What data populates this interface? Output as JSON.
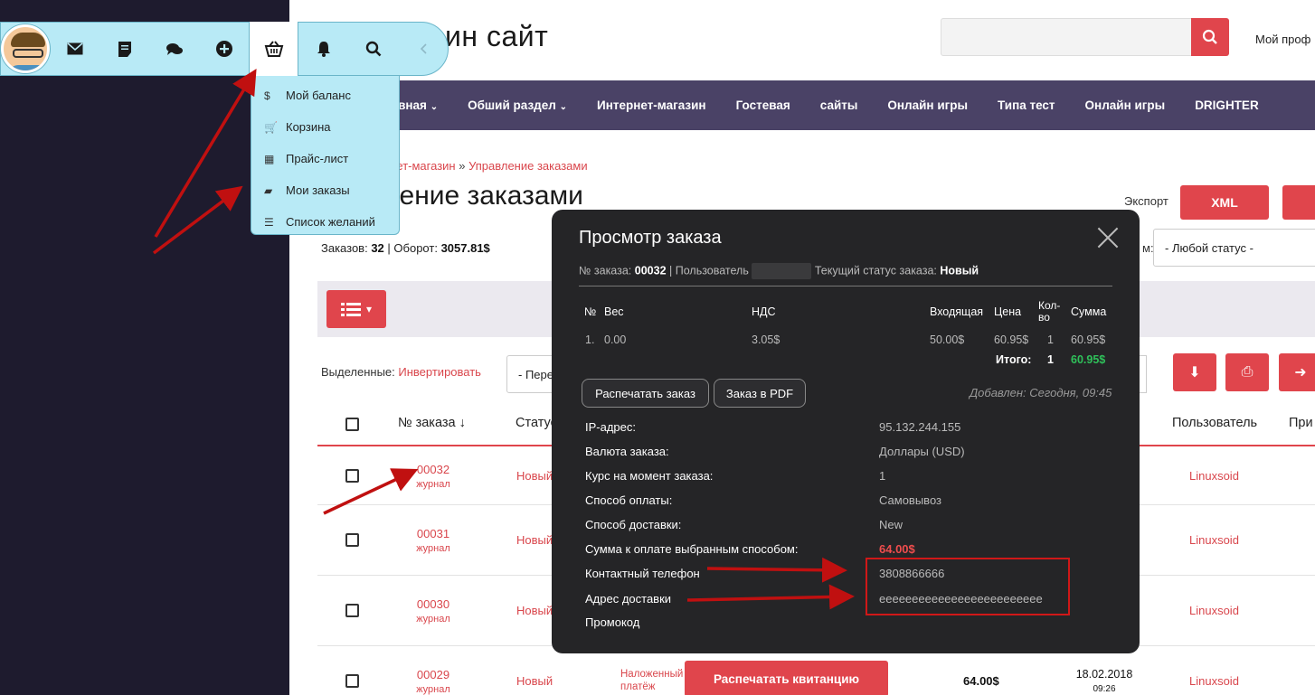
{
  "site": {
    "title": "ин сайт",
    "profile_label": "Мой проф"
  },
  "toolbar": {
    "icons": [
      "mail-icon",
      "notes-icon",
      "chat-icon",
      "plus-icon",
      "basket-icon",
      "bell-icon",
      "search-icon",
      "chevron-left-icon"
    ]
  },
  "dropdown": {
    "items": [
      {
        "icon": "$",
        "label": "Мой баланс"
      },
      {
        "icon": "🛒",
        "label": "Корзина"
      },
      {
        "icon": "▦",
        "label": "Прайс-лист"
      },
      {
        "icon": "▰",
        "label": "Мои заказы"
      },
      {
        "icon": "☰",
        "label": "Список желаний"
      }
    ]
  },
  "nav": {
    "items": [
      "лавная",
      "Обший раздел",
      "Интернет-магазин",
      "Гостевая",
      "сайты",
      "Онлайн игры",
      "Типа тест",
      "Онлайн игры",
      "DRIGHTER"
    ]
  },
  "breadcrumb": {
    "part1": "рнет-магазин",
    "separator": " » ",
    "part2": "Управление заказами"
  },
  "page": {
    "title": "ление заказами",
    "export_label": "Экспорт",
    "xml_label": "XML",
    "stats_orders_label": "Заказов:",
    "stats_orders": "32",
    "stats_turnover_label": "Оборот:",
    "stats_turnover": "3057.81$",
    "status_label": "м:",
    "status_value": "- Любой статус -",
    "selected_label": "Выделенные:",
    "invert_link": "Инвертировать",
    "bulk_value": "- Пере"
  },
  "table": {
    "headers": {
      "order_no": "№ заказа ↓",
      "status": "Статус",
      "user": "Пользователь",
      "note": "При"
    },
    "rows": [
      {
        "num": "00032",
        "sub": "журнал",
        "status": "Новый",
        "user": "Linuxsoid"
      },
      {
        "num": "00031",
        "sub": "журнал",
        "status": "Новый",
        "user": "Linuxsoid"
      },
      {
        "num": "00030",
        "sub": "журнал",
        "status": "Новый",
        "user": "Linuxsoid"
      },
      {
        "num": "00029",
        "sub": "журнал",
        "status": "Новый",
        "user": "Linuxsoid",
        "payment": "Наложенный платёж",
        "print_label": "Распечатать квитанцию",
        "sum": "64.00$",
        "date": "18.02.2018",
        "time": "09:26"
      }
    ]
  },
  "modal": {
    "title": "Просмотр заказа",
    "order_label": "№ заказа:",
    "order_no": "00032",
    "user_label": "| Пользователь",
    "status_label": "Текущий статус заказа:",
    "status_value": "Новый",
    "cols": {
      "no": "№",
      "weight": "Вес",
      "vat": "НДС",
      "incoming": "Входящая",
      "price": "Цена",
      "qty_line1": "Кол-",
      "qty_line2": "во",
      "sum": "Сумма"
    },
    "item": {
      "no": "1.",
      "weight": "0.00",
      "vat": "3.05$",
      "incoming": "50.00$",
      "price": "60.95$",
      "qty": "1",
      "sum": "60.95$"
    },
    "total_label": "Итого:",
    "total_qty": "1",
    "total_sum": "60.95$",
    "print_btn": "Распечатать заказ",
    "pdf_btn": "Заказ в PDF",
    "added": "Добавлен: Сегодня, 09:45",
    "details": [
      {
        "label": "IP-адрес:",
        "value": "95.132.244.155"
      },
      {
        "label": "Валюта заказа:",
        "value": "Доллары (USD)"
      },
      {
        "label": "Курс на момент заказа:",
        "value": "1"
      },
      {
        "label": "Способ оплаты:",
        "value": "Самовывоз"
      },
      {
        "label": "Способ доставки:",
        "value": "New"
      },
      {
        "label": "Сумма к оплате выбранным способом:",
        "value": "64.00$"
      },
      {
        "label": "Контактный телефон",
        "value": "3808866666"
      },
      {
        "label": "Адрес доставки",
        "value": "eeeeeeeeeeeeeeeeeeeeeeeee"
      },
      {
        "label": "Промокод",
        "value": ""
      }
    ]
  },
  "colors": {
    "accent": "#e0454c",
    "nav_bg": "#4a4266",
    "toolbar_bg": "#b8eaf6",
    "modal_bg": "#252527",
    "annotation": "#c01010",
    "total_green": "#2fc15a"
  }
}
